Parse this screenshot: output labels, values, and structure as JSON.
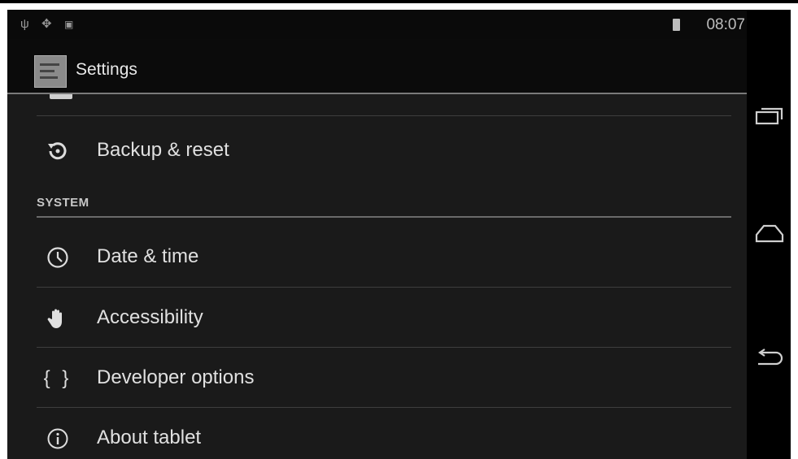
{
  "status_bar": {
    "time": "08:07",
    "icons": [
      "usb-icon",
      "android-debug-icon",
      "notification-icon"
    ]
  },
  "action_bar": {
    "title": "Settings",
    "icon": "settings-app-icon"
  },
  "list": {
    "items_before_section": [
      {
        "label": "Backup & reset",
        "icon": "backup-reset-icon"
      }
    ],
    "section": {
      "title": "SYSTEM",
      "items": [
        {
          "label": "Date & time",
          "icon": "clock-icon"
        },
        {
          "label": "Accessibility",
          "icon": "hand-icon"
        },
        {
          "label": "Developer options",
          "icon": "braces-icon"
        },
        {
          "label": "About tablet",
          "icon": "info-icon"
        }
      ]
    }
  },
  "navigation": {
    "buttons": [
      "recent-apps-icon",
      "home-icon",
      "back-icon"
    ]
  }
}
